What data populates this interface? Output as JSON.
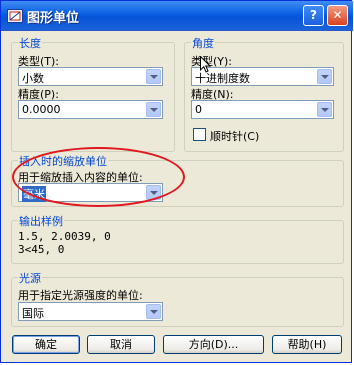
{
  "window": {
    "title": "图形单位",
    "help_glyph": "?",
    "close_glyph": "✕"
  },
  "length": {
    "group_title": "长度",
    "type_label": "类型(T):",
    "type_value": "小数",
    "precision_label": "精度(P):",
    "precision_value": "0.0000"
  },
  "angle": {
    "group_title": "角度",
    "type_label": "类型(Y):",
    "type_value": "十进制度数",
    "precision_label": "精度(N):",
    "precision_value": "0",
    "clockwise_label": "顺时针(C)",
    "clockwise_checked": false
  },
  "insertion": {
    "group_title": "插入时的缩放单位",
    "prompt_label": "用于缩放插入内容的单位:",
    "value": "毫米"
  },
  "output_sample": {
    "group_title": "输出样例",
    "line1": "1.5, 2.0039, 0",
    "line2": "3<45, 0"
  },
  "lighting": {
    "group_title": "光源",
    "prompt_label": "用于指定光源强度的单位:",
    "value": "国际"
  },
  "buttons": {
    "ok": "确定",
    "cancel": "取消",
    "direction": "方向(D)...",
    "help": "帮助(H)"
  },
  "colors": {
    "title_bar": "#0a5fe4",
    "group_title": "#0046d5",
    "annotation": "#e0181f",
    "selection": "#316ac5"
  }
}
